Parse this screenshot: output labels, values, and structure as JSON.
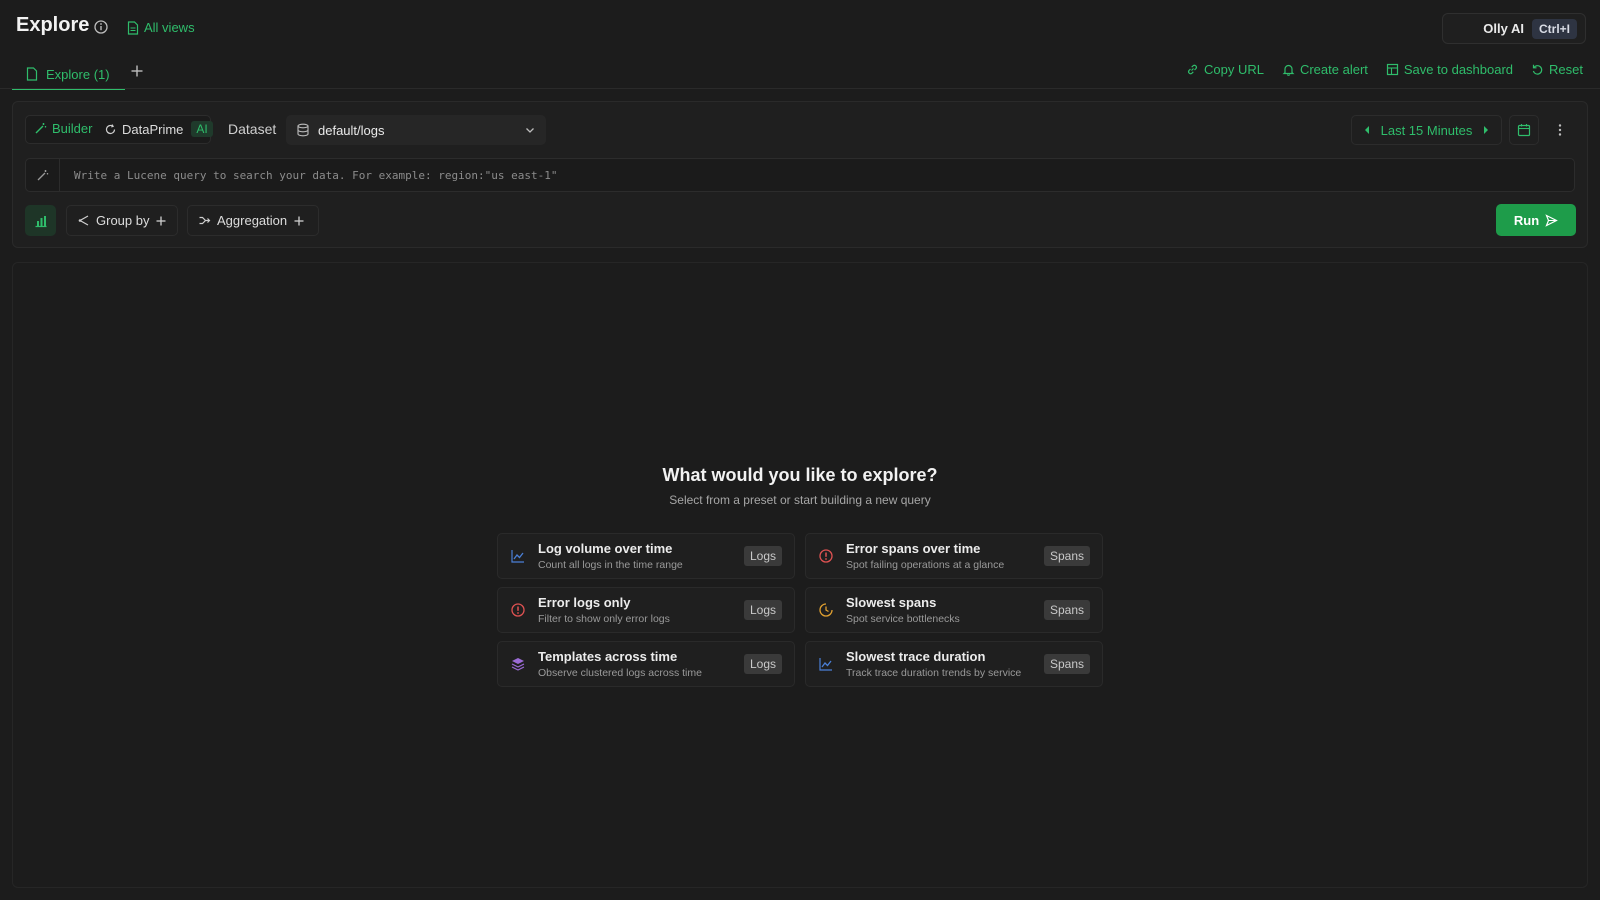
{
  "header": {
    "title": "Explore",
    "all_views": "All views",
    "olly_label": "Olly AI",
    "olly_shortcut": "Ctrl+I"
  },
  "tabs": [
    {
      "label": "Explore (1)",
      "active": true
    }
  ],
  "actions": {
    "copy_url": "Copy URL",
    "create_alert": "Create alert",
    "save_to_dashboard": "Save to dashboard",
    "reset": "Reset"
  },
  "query": {
    "mode_builder": "Builder",
    "mode_dataprime": "DataPrime",
    "ai_badge": "AI",
    "dataset_label": "Dataset",
    "dataset_value": "default/logs",
    "time_range": "Last 15 Minutes",
    "placeholder": "Write a Lucene query to search your data. For example: region:\"us east-1\"",
    "group_by": "Group by",
    "aggregation": "Aggregation",
    "run": "Run"
  },
  "empty_state": {
    "title": "What would you like to explore?",
    "subtitle": "Select from a preset or start building a new query"
  },
  "presets": [
    {
      "title": "Log volume over time",
      "desc": "Count all logs in the time range",
      "tag": "Logs",
      "icon": "line-chart-icon"
    },
    {
      "title": "Error spans over time",
      "desc": "Spot failing operations at a glance",
      "tag": "Spans",
      "icon": "alert-circle-icon"
    },
    {
      "title": "Error logs only",
      "desc": "Filter to show only error logs",
      "tag": "Logs",
      "icon": "alert-circle-icon"
    },
    {
      "title": "Slowest spans",
      "desc": "Spot service bottlenecks",
      "tag": "Spans",
      "icon": "clock-icon"
    },
    {
      "title": "Templates across time",
      "desc": "Observe clustered logs across time",
      "tag": "Logs",
      "icon": "layers-icon"
    },
    {
      "title": "Slowest trace duration",
      "desc": "Track trace duration trends by service",
      "tag": "Spans",
      "icon": "line-chart-icon"
    }
  ],
  "colors": {
    "accent": "#2fbd6b",
    "run_button": "#1e9c4a",
    "background": "#1c1c1c",
    "error": "#e05252",
    "warning": "#e0a030",
    "purple": "#9b6bd6",
    "chart_blue": "#4a7fd6"
  }
}
